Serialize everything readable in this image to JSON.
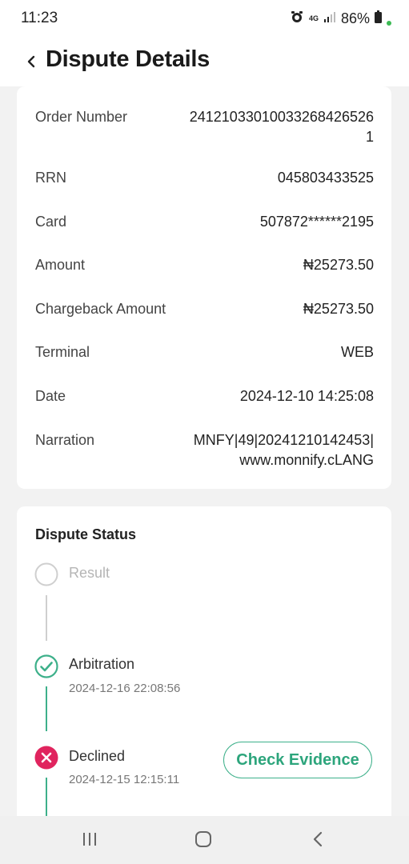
{
  "status_bar": {
    "time": "11:23",
    "network": "4G",
    "battery": "86%"
  },
  "header": {
    "title": "Dispute Details"
  },
  "details": {
    "order_number_label": "Order Number",
    "order_number_line1": "241210330100332684265​26",
    "order_number_line2": "1",
    "rrn_label": "RRN",
    "rrn_value": "045803433525",
    "card_label": "Card",
    "card_value": "507872******2195",
    "amount_label": "Amount",
    "amount_value": "₦25273.50",
    "chargeback_label": "Chargeback Amount",
    "chargeback_value": "₦25273.50",
    "terminal_label": "Terminal",
    "terminal_value": "WEB",
    "date_label": "Date",
    "date_value": "2024-12-10 14:25:08",
    "narration_label": "Narration",
    "narration_line1": "MNFY|49|20241210142453|",
    "narration_line2": "www.monnify.cLANG"
  },
  "dispute_status": {
    "title": "Dispute Status",
    "steps": [
      {
        "label": "Result",
        "date": "",
        "state": "pending"
      },
      {
        "label": "Arbitration",
        "date": "2024-12-16 22:08:56",
        "state": "done"
      },
      {
        "label": "Declined",
        "date": "2024-12-15 12:15:11",
        "state": "declined"
      }
    ],
    "check_evidence_label": "Check Evidence"
  },
  "colors": {
    "accent_green": "#3db08a",
    "declined_red": "#e0245e",
    "pending_gray": "#cfcfcf"
  }
}
